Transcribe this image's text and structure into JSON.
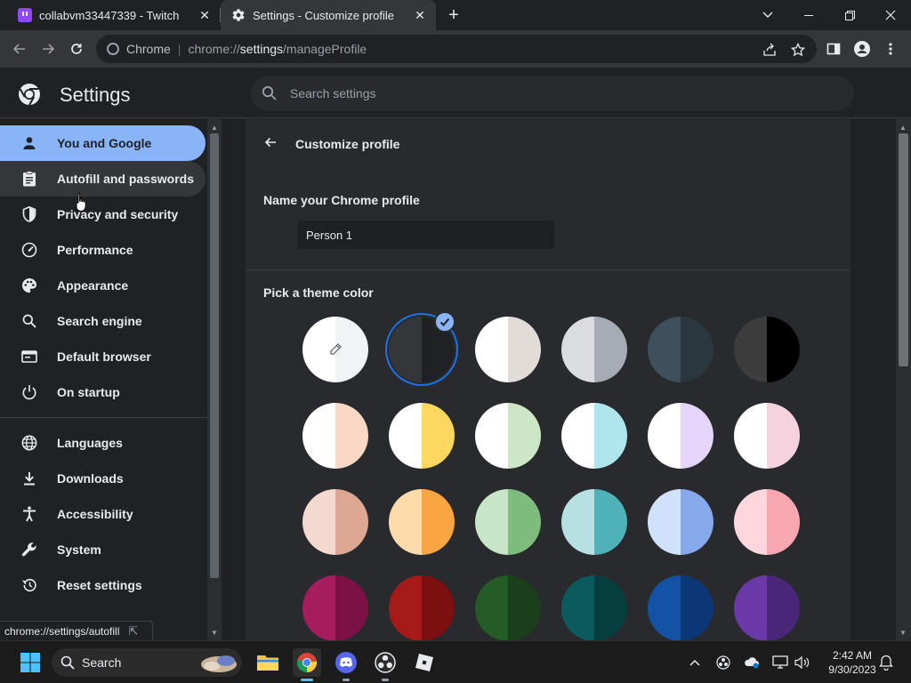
{
  "tabs": [
    {
      "title": "collabvm33447339 - Twitch",
      "active": false
    },
    {
      "title": "Settings - Customize profile",
      "active": true
    }
  ],
  "omnibox": {
    "chip": "Chrome",
    "url_scheme": "chrome://",
    "url_host": "settings",
    "url_path": "/manageProfile"
  },
  "header": {
    "title": "Settings",
    "search_placeholder": "Search settings"
  },
  "sidebar": {
    "items": [
      {
        "label": "You and Google",
        "icon": "person-icon",
        "selected": true
      },
      {
        "label": "Autofill and passwords",
        "icon": "clipboard-icon",
        "hovered": true
      },
      {
        "label": "Privacy and security",
        "icon": "shield-icon"
      },
      {
        "label": "Performance",
        "icon": "speedometer-icon"
      },
      {
        "label": "Appearance",
        "icon": "palette-icon"
      },
      {
        "label": "Search engine",
        "icon": "search-icon"
      },
      {
        "label": "Default browser",
        "icon": "browser-icon"
      },
      {
        "label": "On startup",
        "icon": "power-icon"
      },
      {
        "label": "Languages",
        "icon": "globe-icon"
      },
      {
        "label": "Downloads",
        "icon": "download-icon"
      },
      {
        "label": "Accessibility",
        "icon": "accessibility-icon"
      },
      {
        "label": "System",
        "icon": "wrench-icon"
      },
      {
        "label": "Reset settings",
        "icon": "reset-icon"
      }
    ]
  },
  "status_url": "chrome://settings/autofill",
  "main": {
    "subtitle": "Customize profile",
    "name_label": "Name your Chrome profile",
    "name_value": "Person 1",
    "theme_label": "Pick a theme color"
  },
  "swatches": [
    {
      "left": "#ffffff",
      "right": "#f1f3f4",
      "custom": true
    },
    {
      "left": "#35363a",
      "right": "#202124",
      "selected": true
    },
    {
      "left": "#ffffff",
      "right": "#e2dcd9"
    },
    {
      "left": "#dadce0",
      "right": "#a6abb5"
    },
    {
      "left": "#3f505c",
      "right": "#2a373f"
    },
    {
      "left": "#3c3c3c",
      "right": "#000000"
    },
    {
      "left": "#ffffff",
      "right": "#fbd8c6"
    },
    {
      "left": "#ffffff",
      "right": "#fdd760"
    },
    {
      "left": "#ffffff",
      "right": "#cde6c6"
    },
    {
      "left": "#ffffff",
      "right": "#afe6ee"
    },
    {
      "left": "#ffffff",
      "right": "#e6d5fa"
    },
    {
      "left": "#ffffff",
      "right": "#f6d2de"
    },
    {
      "left": "#f4d9d0",
      "right": "#dda794"
    },
    {
      "left": "#fedbab",
      "right": "#f9a541"
    },
    {
      "left": "#c7e6c7",
      "right": "#7dbc7c"
    },
    {
      "left": "#b6e0e2",
      "right": "#4eb2b8"
    },
    {
      "left": "#cfe1fb",
      "right": "#86a9eb"
    },
    {
      "left": "#fdd6de",
      "right": "#f9a7b0"
    },
    {
      "left": "#a51d5d",
      "right": "#7b1144"
    },
    {
      "left": "#a61a1a",
      "right": "#7c1010"
    },
    {
      "left": "#255b26",
      "right": "#1a3f1a"
    },
    {
      "left": "#0b5b5e",
      "right": "#073e40"
    },
    {
      "left": "#1452a5",
      "right": "#0c3776"
    },
    {
      "left": "#6b3aa8",
      "right": "#4a2679"
    }
  ],
  "taskbar": {
    "search_label": "Search",
    "time": "2:42 AM",
    "date": "9/30/2023",
    "apps": [
      "file-explorer-icon",
      "chrome-icon",
      "discord-icon",
      "obs-icon",
      "roblox-icon"
    ]
  },
  "colors": {
    "accent": "#8ab4f8",
    "background": "#202124",
    "card": "#292a2d"
  }
}
